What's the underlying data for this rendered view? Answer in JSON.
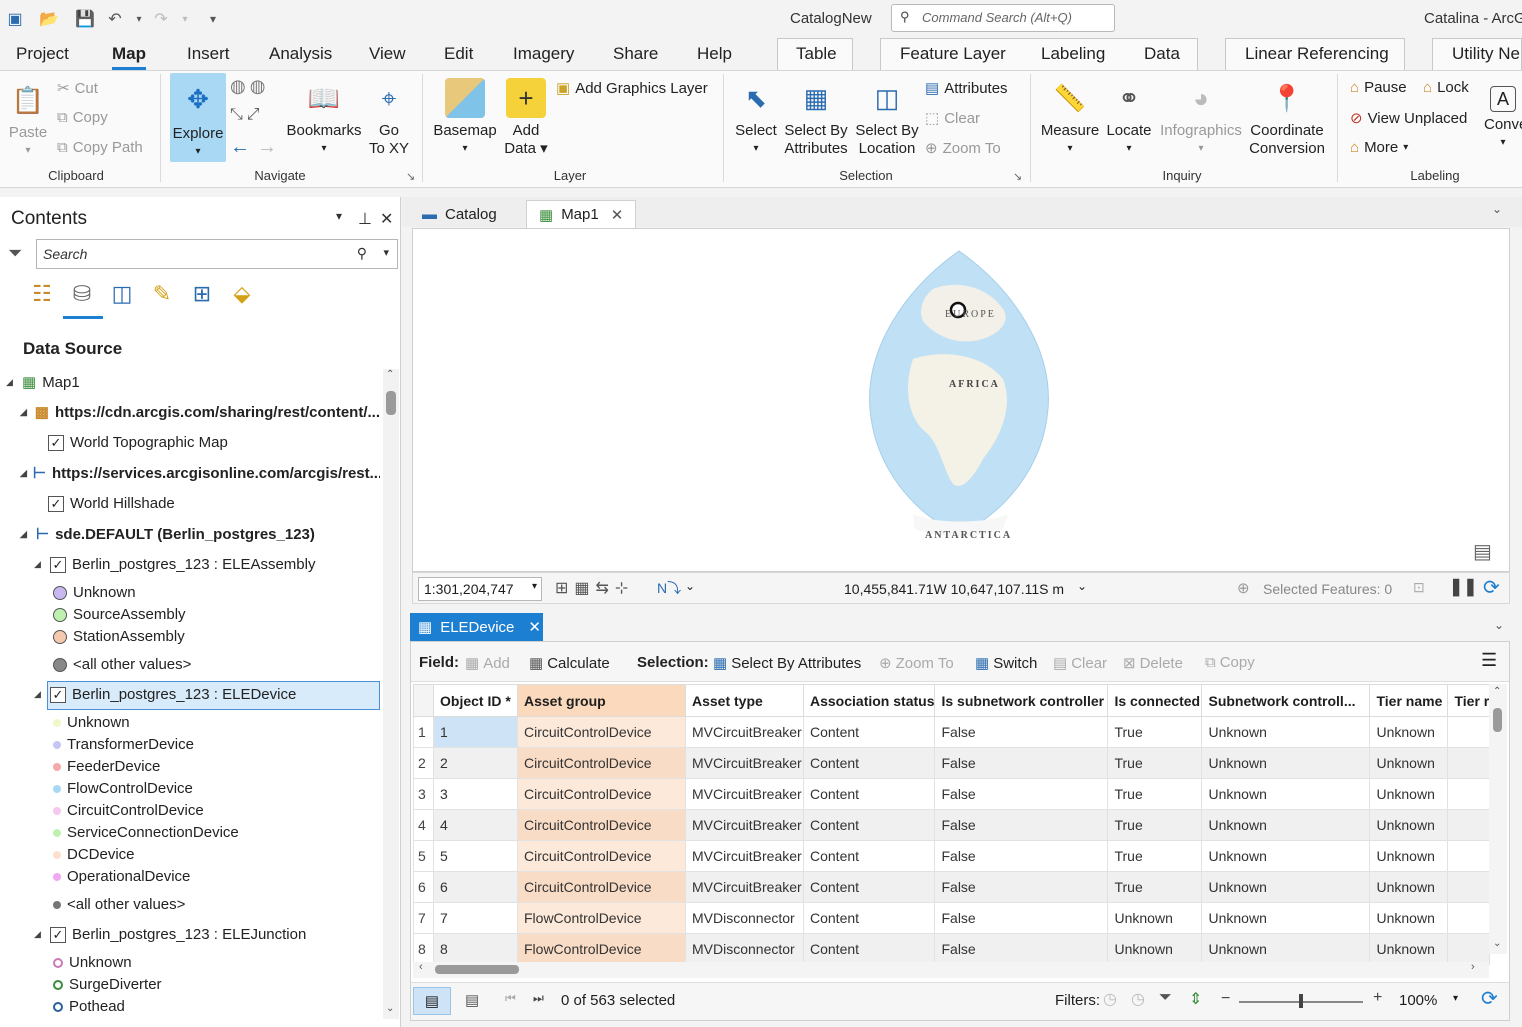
{
  "title_bar": {
    "app_title": "CatalogNew",
    "command_search_placeholder": "Command Search (Alt+Q)",
    "user": "Catalina - ArcG"
  },
  "menu_tabs": [
    "Project",
    "Map",
    "Insert",
    "Analysis",
    "View",
    "Edit",
    "Imagery",
    "Share",
    "Help"
  ],
  "context_tabs": {
    "table": "Table",
    "feature_layer": "Feature Layer",
    "labeling": "Labeling",
    "data": "Data",
    "linear_referencing": "Linear Referencing",
    "utility": "Utility Ne"
  },
  "ribbon": {
    "clipboard": {
      "paste": "Paste",
      "cut": "Cut",
      "copy": "Copy",
      "copy_path": "Copy Path",
      "label": "Clipboard"
    },
    "navigate": {
      "explore": "Explore",
      "bookmarks": "Bookmarks",
      "go_to_xy_1": "Go",
      "go_to_xy_2": "To XY",
      "label": "Navigate"
    },
    "layer": {
      "basemap": "Basemap",
      "add_data_1": "Add",
      "add_data_2": "Data",
      "add_graphics_layer": "Add Graphics Layer",
      "label": "Layer"
    },
    "selection": {
      "select": "Select",
      "select_by_attr_1": "Select By",
      "select_by_attr_2": "Attributes",
      "select_by_loc_1": "Select By",
      "select_by_loc_2": "Location",
      "attributes": "Attributes",
      "clear": "Clear",
      "zoom_to": "Zoom To",
      "label": "Selection"
    },
    "inquiry": {
      "measure": "Measure",
      "locate": "Locate",
      "infographics": "Infographics",
      "coord_1": "Coordinate",
      "coord_2": "Conversion",
      "label": "Inquiry"
    },
    "labeling": {
      "pause": "Pause",
      "lock": "Lock",
      "view_unplaced": "View Unplaced",
      "more": "More",
      "convert": "Conve",
      "label": "Labeling"
    }
  },
  "contents": {
    "title": "Contents",
    "search_placeholder": "Search",
    "section": "Data Source",
    "tree": {
      "map": "Map1",
      "src1": "https://cdn.arcgis.com/sharing/rest/content/...",
      "layer1": "World Topographic Map",
      "src2": "https://services.arcgisonline.com/arcgis/rest...",
      "layer2": "World Hillshade",
      "src3": "sde.DEFAULT (Berlin_postgres_123)",
      "assembly": "Berlin_postgres_123 : ELEAssembly",
      "assembly_classes": [
        "Unknown",
        "SourceAssembly",
        "StationAssembly",
        "<all other values>"
      ],
      "device": "Berlin_postgres_123 : ELEDevice",
      "device_classes": [
        "Unknown",
        "TransformerDevice",
        "FeederDevice",
        "FlowControlDevice",
        "CircuitControlDevice",
        "ServiceConnectionDevice",
        "DCDevice",
        "OperationalDevice",
        "<all other values>"
      ],
      "junction": "Berlin_postgres_123 : ELEJunction",
      "junction_classes": [
        "Unknown",
        "SurgeDiverter",
        "Pothead"
      ]
    }
  },
  "views": {
    "catalog_tab": "Catalog",
    "map_tab": "Map1"
  },
  "map": {
    "label_europe": "EUROPE",
    "label_africa": "AFRICA",
    "label_antarctica": "ANTARCTICA",
    "scale": "1:301,204,747",
    "coords": "10,455,841.71W 10,647,107.11S m",
    "selected_features": "Selected Features: 0"
  },
  "attr_table": {
    "tab": "ELEDevice",
    "toolbar": {
      "field": "Field:",
      "add": "Add",
      "calculate": "Calculate",
      "selection": "Selection:",
      "select_by_attributes": "Select By Attributes",
      "zoom_to": "Zoom To",
      "switch": "Switch",
      "clear": "Clear",
      "delete": "Delete",
      "copy": "Copy"
    },
    "columns": [
      "Object ID *",
      "Asset group",
      "Asset type",
      "Association status",
      "Is subnetwork controller",
      "Is connected",
      "Subnetwork controll...",
      "Tier name",
      "Tier r"
    ],
    "rows": [
      [
        "1",
        "1",
        "CircuitControlDevice",
        "MVCircuitBreaker",
        "Content",
        "False",
        "True",
        "Unknown",
        "Unknown"
      ],
      [
        "2",
        "2",
        "CircuitControlDevice",
        "MVCircuitBreaker",
        "Content",
        "False",
        "True",
        "Unknown",
        "Unknown"
      ],
      [
        "3",
        "3",
        "CircuitControlDevice",
        "MVCircuitBreaker",
        "Content",
        "False",
        "True",
        "Unknown",
        "Unknown"
      ],
      [
        "4",
        "4",
        "CircuitControlDevice",
        "MVCircuitBreaker",
        "Content",
        "False",
        "True",
        "Unknown",
        "Unknown"
      ],
      [
        "5",
        "5",
        "CircuitControlDevice",
        "MVCircuitBreaker",
        "Content",
        "False",
        "True",
        "Unknown",
        "Unknown"
      ],
      [
        "6",
        "6",
        "CircuitControlDevice",
        "MVCircuitBreaker",
        "Content",
        "False",
        "True",
        "Unknown",
        "Unknown"
      ],
      [
        "7",
        "7",
        "FlowControlDevice",
        "MVDisconnector",
        "Content",
        "False",
        "Unknown",
        "Unknown",
        "Unknown"
      ],
      [
        "8",
        "8",
        "FlowControlDevice",
        "MVDisconnector",
        "Content",
        "False",
        "Unknown",
        "Unknown",
        "Unknown"
      ]
    ],
    "status": {
      "selected": "0 of 563 selected",
      "filters": "Filters:",
      "zoom": "100%"
    }
  },
  "colors": {
    "accent": "#1d7fd1",
    "explore_bg": "#a9d8f5",
    "asset_group_col": "#fde9d9"
  }
}
